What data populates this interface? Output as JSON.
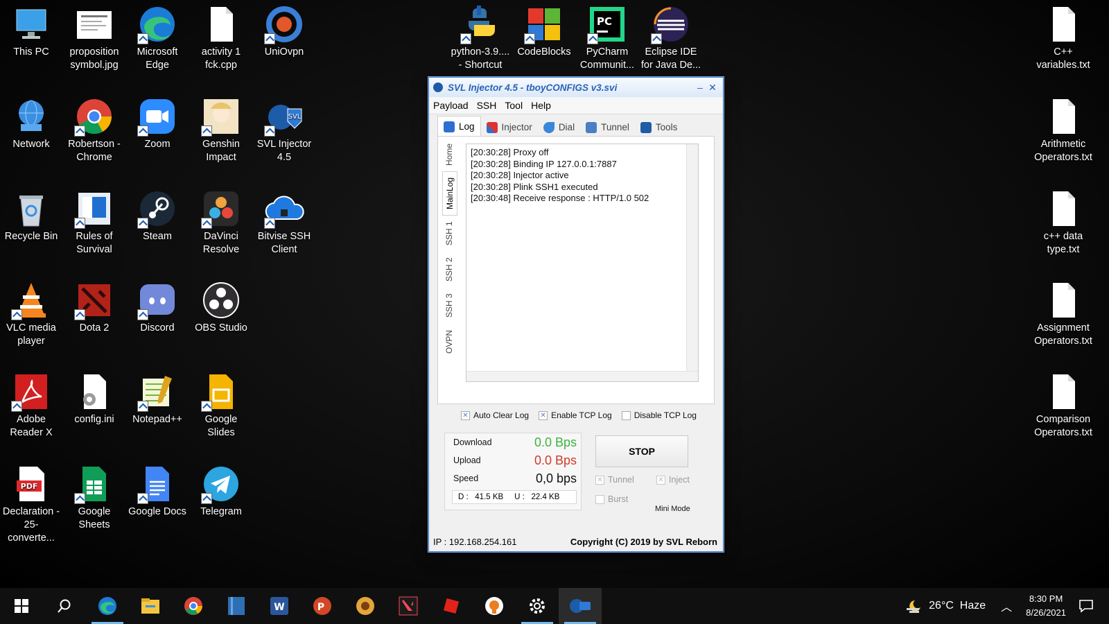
{
  "desktop_icons": [
    {
      "label": "This PC",
      "icon": "this-pc-icon"
    },
    {
      "label": "proposition symbol.jpg",
      "icon": "image-file-icon"
    },
    {
      "label": "Microsoft Edge",
      "icon": "edge-icon"
    },
    {
      "label": "activity 1 fck.cpp",
      "icon": "file-icon"
    },
    {
      "label": "UniOvpn",
      "icon": "uniovpn-icon"
    },
    {
      "label": "Network",
      "icon": "network-icon"
    },
    {
      "label": "Robertson - Chrome",
      "icon": "chrome-icon"
    },
    {
      "label": "Zoom",
      "icon": "zoom-icon"
    },
    {
      "label": "Genshin Impact",
      "icon": "genshin-icon"
    },
    {
      "label": "SVL Injector 4.5",
      "icon": "svl-injector-icon"
    },
    {
      "label": "Recycle Bin",
      "icon": "recycle-bin-icon"
    },
    {
      "label": "Rules of Survival",
      "icon": "ros-icon"
    },
    {
      "label": "Steam",
      "icon": "steam-icon"
    },
    {
      "label": "DaVinci Resolve",
      "icon": "davinci-icon"
    },
    {
      "label": "Bitvise SSH Client",
      "icon": "bitvise-icon"
    },
    {
      "label": "VLC media player",
      "icon": "vlc-icon"
    },
    {
      "label": "Dota 2",
      "icon": "dota-icon"
    },
    {
      "label": "Discord",
      "icon": "discord-icon"
    },
    {
      "label": "OBS Studio",
      "icon": "obs-icon"
    },
    {
      "label": "Adobe Reader X",
      "icon": "adobe-reader-icon"
    },
    {
      "label": "config.ini",
      "icon": "config-file-icon"
    },
    {
      "label": "Notepad++",
      "icon": "notepadpp-icon"
    },
    {
      "label": "Google Slides",
      "icon": "slides-icon"
    },
    {
      "label": "Declaration - 25-converte...",
      "icon": "pdf-icon"
    },
    {
      "label": "Google Sheets",
      "icon": "sheets-icon"
    },
    {
      "label": "Google Docs",
      "icon": "docs-icon"
    },
    {
      "label": "Telegram",
      "icon": "telegram-icon"
    },
    {
      "label": "python-3.9.... - Shortcut",
      "icon": "python-icon"
    },
    {
      "label": "CodeBlocks",
      "icon": "codeblocks-icon"
    },
    {
      "label": "PyCharm Communit...",
      "icon": "pycharm-icon"
    },
    {
      "label": "Eclipse IDE for Java De...",
      "icon": "eclipse-icon"
    },
    {
      "label": "C++ variables.txt",
      "icon": "text-file-icon"
    },
    {
      "label": "Arithmetic Operators.txt",
      "icon": "text-file-icon"
    },
    {
      "label": "c++ data type.txt",
      "icon": "text-file-icon"
    },
    {
      "label": "Assignment Operators.txt",
      "icon": "text-file-icon"
    },
    {
      "label": "Comparison Operators.txt",
      "icon": "text-file-icon"
    }
  ],
  "window": {
    "title": "SVL Injector 4.5 - tboyCONFIGS v3.svi",
    "minimize": "–",
    "close": "✕",
    "menu": [
      "Payload",
      "SSH",
      "Tool",
      "Help"
    ],
    "tabs": [
      "Log",
      "Injector",
      "Dial",
      "Tunnel",
      "Tools"
    ],
    "vertical_tabs": [
      "Home",
      "MainLog",
      "SSH 1",
      "SSH 2",
      "SSH 3",
      "OVPN"
    ],
    "log_lines": [
      "[20:30:28] Proxy off",
      "[20:30:28] Binding IP 127.0.0.1:7887",
      "[20:30:28] Injector active",
      "[20:30:28] Plink SSH1 executed",
      "[20:30:48] Receive response : HTTP/1.0 502"
    ],
    "checks": [
      {
        "label": "Auto Clear Log",
        "checked": true
      },
      {
        "label": "Enable TCP Log",
        "checked": true
      },
      {
        "label": "Disable TCP Log",
        "checked": false
      }
    ],
    "stats": {
      "download_label": "Download",
      "download_value": "0.0 Bps",
      "upload_label": "Upload",
      "upload_value": "0.0 Bps",
      "speed_label": "Speed",
      "speed_value": "0,0 bps",
      "summary": "D :   41.5 KB     U :   22.4 KB"
    },
    "stop_label": "STOP",
    "options": {
      "tunnel": "Tunnel",
      "inject": "Inject",
      "burst": "Burst"
    },
    "mini_mode": "Mini Mode",
    "ip": "IP : 192.168.254.161",
    "copyright": "Copyright (C) 2019 by SVL Reborn"
  },
  "taskbar": {
    "apps": [
      "start",
      "search",
      "edge",
      "file-explorer",
      "chrome",
      "book-app",
      "word",
      "powerpoint",
      "whatsapp-app",
      "valorant",
      "roblox",
      "ovpn",
      "settings",
      "svl-injector"
    ],
    "weather": "26°C  Haze",
    "time": "8:30 PM",
    "date": "8/26/2021"
  }
}
